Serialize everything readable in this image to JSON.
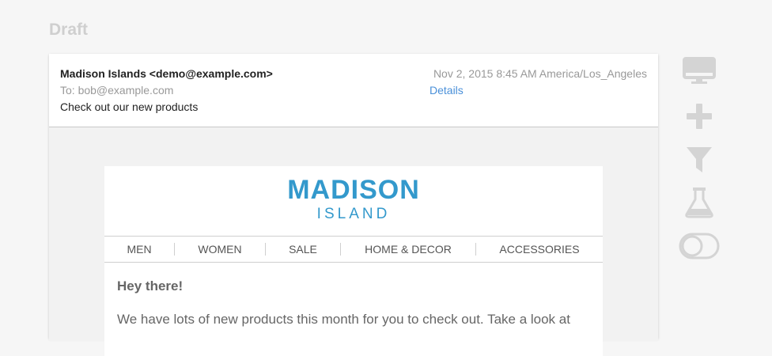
{
  "page": {
    "draft_label": "Draft"
  },
  "email": {
    "from": "Madison Islands <demo@example.com>",
    "to": "To: bob@example.com",
    "subject": "Check out our new products",
    "date": "Nov 2, 2015 8:45 AM America/Los_Angeles",
    "details_link": "Details"
  },
  "newsletter": {
    "logo_main": "MADISON",
    "logo_sub": "ISLAND",
    "nav": [
      "MEN",
      "WOMEN",
      "SALE",
      "HOME & DECOR",
      "ACCESSORIES"
    ],
    "greeting": "Hey there!",
    "paragraph": "We have lots of new products this month for you to check out. Take a look at"
  },
  "side_tools": [
    {
      "icon": "desktop-icon"
    },
    {
      "icon": "plus-icon"
    },
    {
      "icon": "filter-icon"
    },
    {
      "icon": "flask-icon"
    },
    {
      "icon": "toggle-icon"
    }
  ],
  "colors": {
    "brand": "#3399cc",
    "link": "#4a90d9",
    "icon_gray": "#d4d4d4"
  }
}
